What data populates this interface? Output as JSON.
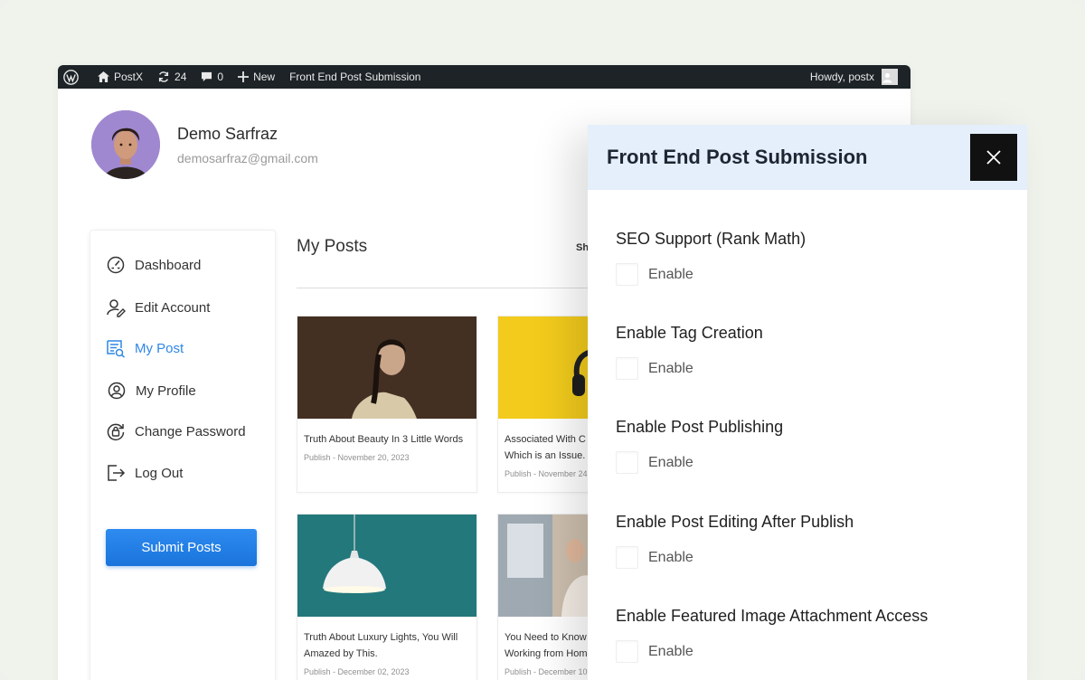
{
  "adminbar": {
    "site_name": "PostX",
    "updates_count": "24",
    "comments_count": "0",
    "new_label": "New",
    "page_label": "Front End Post Submission",
    "howdy": "Howdy, postx"
  },
  "profile": {
    "name": "Demo Sarfraz",
    "email": "demosarfraz@gmail.com"
  },
  "sidebar": {
    "items": [
      {
        "label": "Dashboard",
        "icon": "dashboard-gauge-icon"
      },
      {
        "label": "Edit Account",
        "icon": "user-edit-icon"
      },
      {
        "label": "My Post",
        "icon": "post-list-icon",
        "active": true
      },
      {
        "label": "My Profile",
        "icon": "user-circle-icon"
      },
      {
        "label": "Change Password",
        "icon": "password-lock-icon"
      },
      {
        "label": "Log Out",
        "icon": "logout-icon"
      }
    ],
    "submit_label": "Submit Posts"
  },
  "posts": {
    "title": "My Posts",
    "sort_label_partial": "Sh",
    "cards": [
      {
        "title": "Truth About Beauty In 3 Little Words",
        "meta": "Publish - November 20, 2023"
      },
      {
        "title": "Associated With C… Which is an Issue.",
        "title_line1": "Associated With C",
        "title_line2": "Which is an Issue.",
        "meta": "Publish - November 24"
      },
      {
        "title": "Truth About Luxury Lights, You Will Amazed by This.",
        "meta": "Publish - December 02, 2023"
      },
      {
        "title": "You Need to Know… Working from Hom",
        "title_line1": "You Need to Know",
        "title_line2": "Working from Hom",
        "meta": "Publish - December 10"
      }
    ]
  },
  "panel": {
    "title": "Front End Post Submission",
    "settings": [
      {
        "label": "SEO Support (Rank Math)",
        "option": "Enable"
      },
      {
        "label": "Enable Tag Creation",
        "option": "Enable"
      },
      {
        "label": "Enable Post Publishing",
        "option": "Enable"
      },
      {
        "label": "Enable Post Editing After Publish",
        "option": "Enable"
      },
      {
        "label": "Enable Featured Image Attachment Access",
        "option": "Enable"
      }
    ]
  },
  "colors": {
    "accent": "#2f87e6",
    "adminbar": "#1d2327",
    "panel_header": "#e4effb"
  }
}
